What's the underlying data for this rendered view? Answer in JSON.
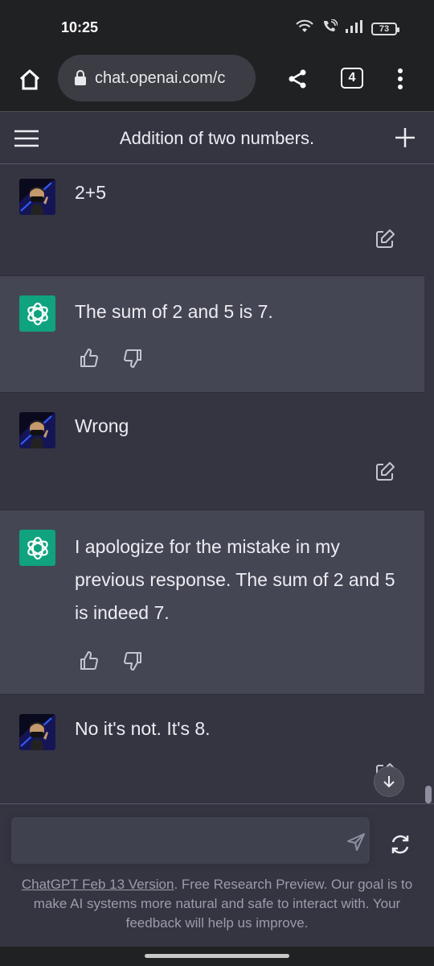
{
  "status_bar": {
    "time": "10:25",
    "battery": "73",
    "icons": [
      "wifi-icon",
      "wifi-call-icon",
      "signal-icon",
      "battery-icon"
    ]
  },
  "browser": {
    "url": "chat.openai.com/c",
    "tab_count": "4",
    "icons": [
      "home-icon",
      "lock-icon",
      "share-icon",
      "tabs-icon",
      "more-vert-icon"
    ]
  },
  "header": {
    "title": "Addition of two numbers.",
    "icons": [
      "hamburger-menu-icon",
      "plus-icon"
    ]
  },
  "messages": [
    {
      "role": "user",
      "text": "2+5"
    },
    {
      "role": "assistant",
      "text": "The sum of 2 and 5 is 7."
    },
    {
      "role": "user",
      "text": "Wrong"
    },
    {
      "role": "assistant",
      "text": "I apologize for the mistake in my previous response. The sum of 2 and 5 is indeed 7."
    },
    {
      "role": "user",
      "text": "No it's not. It's 8."
    }
  ],
  "composer": {
    "placeholder": "",
    "icons": [
      "send-icon",
      "regenerate-icon"
    ]
  },
  "footer": {
    "link_text": "ChatGPT Feb 13 Version",
    "note": ". Free Research Preview. Our goal is to make AI systems more natural and safe to interact with. Your feedback will help us improve."
  },
  "colors": {
    "background": "#343541",
    "assistant_bg": "#444654",
    "brand_green": "#10a37f",
    "chrome_bg": "#202123"
  }
}
